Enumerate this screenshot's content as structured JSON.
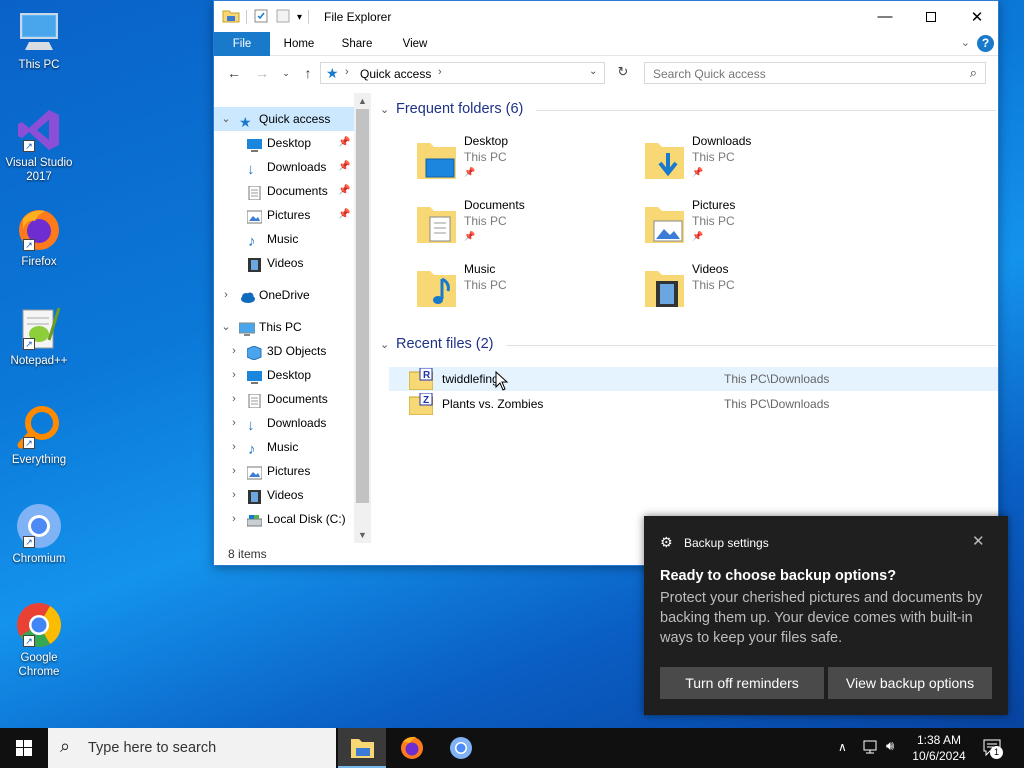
{
  "desktop": {
    "icons": [
      {
        "label": "This PC"
      },
      {
        "label": "Visual Studio 2017"
      },
      {
        "label": "Firefox"
      },
      {
        "label": "Notepad++"
      },
      {
        "label": "Everything"
      },
      {
        "label": "Chromium"
      },
      {
        "label": "Google Chrome"
      }
    ]
  },
  "explorer": {
    "title": "File Explorer",
    "ribbon_tabs": [
      "File",
      "Home",
      "Share",
      "View"
    ],
    "address": "Quick access",
    "search_placeholder": "Search Quick access",
    "status": "8 items",
    "nav": [
      {
        "label": "Quick access",
        "icon": "star-icon"
      },
      {
        "label": "Desktop",
        "icon": "desktop-icon"
      },
      {
        "label": "Downloads",
        "icon": "download-arrow-icon"
      },
      {
        "label": "Documents",
        "icon": "document-icon"
      },
      {
        "label": "Pictures",
        "icon": "pictures-icon"
      },
      {
        "label": "Music",
        "icon": "music-note-icon"
      },
      {
        "label": "Videos",
        "icon": "film-icon"
      },
      {
        "label": "OneDrive",
        "icon": "cloud-icon"
      },
      {
        "label": "This PC",
        "icon": "monitor-icon"
      },
      {
        "label": "3D Objects",
        "icon": "cube-icon"
      },
      {
        "label": "Desktop",
        "icon": "desktop-icon"
      },
      {
        "label": "Documents",
        "icon": "document-icon"
      },
      {
        "label": "Downloads",
        "icon": "download-arrow-icon"
      },
      {
        "label": "Music",
        "icon": "music-note-icon"
      },
      {
        "label": "Pictures",
        "icon": "pictures-icon"
      },
      {
        "label": "Videos",
        "icon": "film-icon"
      },
      {
        "label": "Local Disk (C:)",
        "icon": "disk-icon"
      }
    ],
    "frequent_header": "Frequent folders (6)",
    "frequent": [
      {
        "name": "Desktop",
        "sub": "This PC"
      },
      {
        "name": "Downloads",
        "sub": "This PC"
      },
      {
        "name": "Documents",
        "sub": "This PC"
      },
      {
        "name": "Pictures",
        "sub": "This PC"
      },
      {
        "name": "Music",
        "sub": "This PC"
      },
      {
        "name": "Videos",
        "sub": "This PC"
      }
    ],
    "recent_header": "Recent files (2)",
    "recent": [
      {
        "name": "twiddlefing",
        "location": "This PC\\Downloads",
        "badge": "R"
      },
      {
        "name": "Plants vs. Zombies",
        "location": "This PC\\Downloads",
        "badge": "Z"
      }
    ]
  },
  "toast": {
    "app": "Backup settings",
    "title": "Ready to choose backup options?",
    "body": "Protect your cherished pictures and documents by backing them up. Your device comes with built-in ways to keep your files safe.",
    "button1": "Turn off reminders",
    "button2": "View backup options"
  },
  "taskbar": {
    "search_placeholder": "Type here to search",
    "time": "1:38 AM",
    "date": "10/6/2024",
    "notification_count": "1"
  },
  "colors": {
    "accent": "#1979ca",
    "selection": "#cce8ff",
    "folder_yellow": "#f8d775",
    "toast_bg": "#1f1f1f"
  }
}
